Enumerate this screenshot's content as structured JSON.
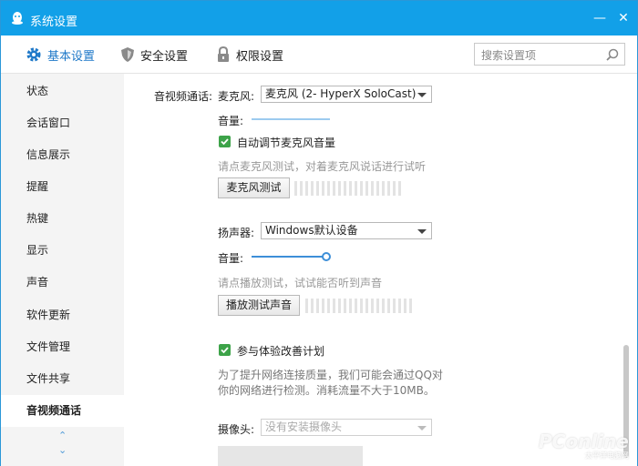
{
  "window": {
    "title": "系统设置",
    "min_symbol": "—",
    "close_symbol": "✕"
  },
  "tabs": [
    {
      "label": "基本设置",
      "icon": "gear-icon"
    },
    {
      "label": "安全设置",
      "icon": "shield-icon"
    },
    {
      "label": "权限设置",
      "icon": "lock-icon"
    }
  ],
  "search": {
    "placeholder": "搜索设置项"
  },
  "sidebar": {
    "items": [
      "状态",
      "会话窗口",
      "信息展示",
      "提醒",
      "热键",
      "显示",
      "声音",
      "软件更新",
      "文件管理",
      "文件共享",
      "音视频通话"
    ],
    "active": "音视频通话",
    "scroll_up": "⌃",
    "scroll_down": "⌄"
  },
  "av": {
    "section_label": "音视频通话:",
    "mic_label": "麦克风:",
    "mic_value": "麦克风 (2- HyperX SoloCast)",
    "mic_volume_label": "音量:",
    "auto_adjust_label": "自动调节麦克风音量",
    "auto_adjust_checked": true,
    "mic_hint": "请点麦克风测试，对着麦克风说话进行试听",
    "mic_test_button": "麦克风测试",
    "speaker_label": "扬声器:",
    "speaker_value": "Windows默认设备",
    "speaker_volume_label": "音量:",
    "speaker_volume": 0.88,
    "speaker_hint": "请点播放测试，试试能否听到声音",
    "speaker_test_button": "播放测试声音",
    "improve_label": "参与体验改善计划",
    "improve_checked": true,
    "improve_desc_line1": "为了提升网络连接质量，我们可能会通过QQ对",
    "improve_desc_line2": "你的网络进行检测。消耗流量不大于10MB。",
    "camera_label": "摄像头:",
    "camera_value": "没有安装摄像头"
  },
  "watermark": {
    "brand": "PConline",
    "sub": "太平洋电脑网"
  },
  "colors": {
    "titlebar": "#12a0e8",
    "accent": "#1e78c8",
    "check": "#3da349"
  }
}
